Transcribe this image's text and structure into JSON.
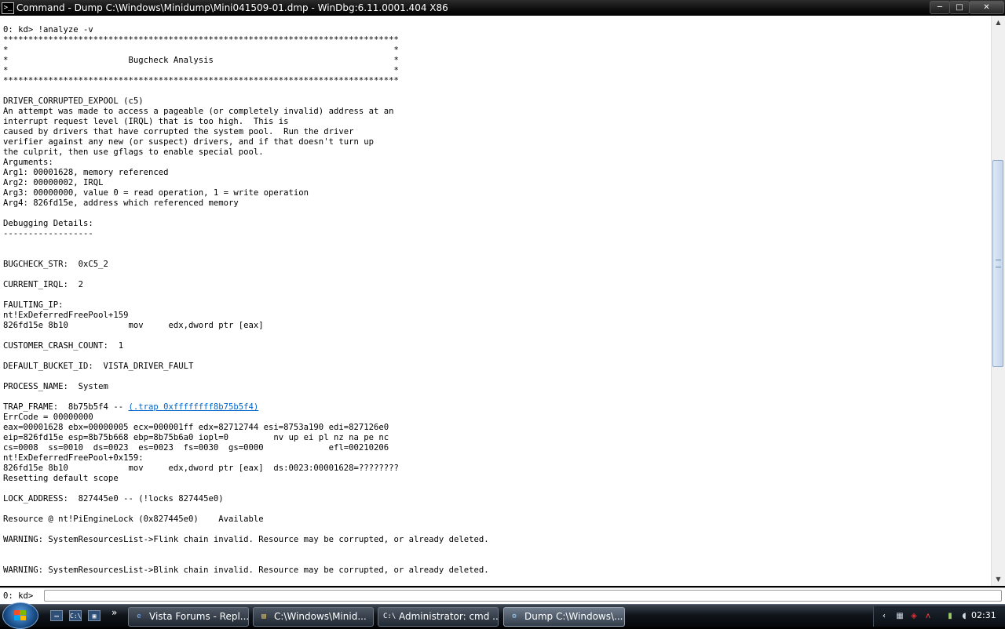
{
  "window": {
    "title": "Command - Dump C:\\Windows\\Minidump\\Mini041509-01.dmp - WinDbg:6.11.0001.404 X86",
    "icon_glyph": ">_",
    "minimize_glyph": "─",
    "maximize_glyph": "□",
    "close_glyph": "✕"
  },
  "output": {
    "lines_before_link": "0: kd> !analyze -v\n*******************************************************************************\n*                                                                             *\n*                        Bugcheck Analysis                                    *\n*                                                                             *\n*******************************************************************************\n\nDRIVER_CORRUPTED_EXPOOL (c5)\nAn attempt was made to access a pageable (or completely invalid) address at an\ninterrupt request level (IRQL) that is too high.  This is\ncaused by drivers that have corrupted the system pool.  Run the driver\nverifier against any new (or suspect) drivers, and if that doesn't turn up\nthe culprit, then use gflags to enable special pool.\nArguments:\nArg1: 00001628, memory referenced\nArg2: 00000002, IRQL\nArg3: 00000000, value 0 = read operation, 1 = write operation\nArg4: 826fd15e, address which referenced memory\n\nDebugging Details:\n------------------\n\n\nBUGCHECK_STR:  0xC5_2\n\nCURRENT_IRQL:  2\n\nFAULTING_IP:\nnt!ExDeferredFreePool+159\n826fd15e 8b10            mov     edx,dword ptr [eax]\n\nCUSTOMER_CRASH_COUNT:  1\n\nDEFAULT_BUCKET_ID:  VISTA_DRIVER_FAULT\n\nPROCESS_NAME:  System\n\nTRAP_FRAME:  8b75b5f4 -- ",
    "trap_link": "(.trap 0xffffffff8b75b5f4)",
    "lines_after_link": "\nErrCode = 00000000\neax=00001628 ebx=00000005 ecx=000001ff edx=82712744 esi=8753a190 edi=827126e0\neip=826fd15e esp=8b75b668 ebp=8b75b6a0 iopl=0         nv up ei pl nz na pe nc\ncs=0008  ss=0010  ds=0023  es=0023  fs=0030  gs=0000             efl=00210206\nnt!ExDeferredFreePool+0x159:\n826fd15e 8b10            mov     edx,dword ptr [eax]  ds:0023:00001628=????????\nResetting default scope\n\nLOCK_ADDRESS:  827445e0 -- (!locks 827445e0)\n\nResource @ nt!PiEngineLock (0x827445e0)    Available\n\nWARNING: SystemResourcesList->Flink chain invalid. Resource may be corrupted, or already deleted.\n\n\nWARNING: SystemResourcesList->Blink chain invalid. Resource may be corrupted, or already deleted."
  },
  "command": {
    "prompt": "0: kd>",
    "value": ""
  },
  "scrollbar": {
    "up_glyph": "▲",
    "down_glyph": "▼",
    "position_fraction": 0.35
  },
  "taskbar": {
    "quicklaunch": [
      {
        "name": "show-desktop",
        "glyph": "▭"
      },
      {
        "name": "cmd",
        "glyph": "C:\\"
      },
      {
        "name": "switch-windows",
        "glyph": "▣"
      }
    ],
    "more_glyph": "»",
    "tasks": [
      {
        "label": "Vista Forums - Repl...",
        "icon": "e",
        "icon_color": "#6fb3ff",
        "active": false
      },
      {
        "label": "C:\\Windows\\Minid...",
        "icon": "▤",
        "icon_color": "#f2d36b",
        "active": false
      },
      {
        "label": "Administrator: cmd ...",
        "icon": "C:\\",
        "icon_color": "#ffffff",
        "active": false
      },
      {
        "label": "Dump C:\\Windows\\...",
        "icon": "⚙",
        "icon_color": "#9fd2ff",
        "active": true
      }
    ],
    "tray_arrow": "‹",
    "tray_icons": [
      {
        "name": "network",
        "glyph": "▦",
        "color": "#cfd8e3"
      },
      {
        "name": "antivirus",
        "glyph": "◈",
        "color": "#e03030"
      },
      {
        "name": "pdf",
        "glyph": "ᴧ",
        "color": "#ff4444"
      },
      {
        "name": "device",
        "glyph": "▮",
        "color": "#9ecb6a"
      },
      {
        "name": "volume",
        "glyph": "◖",
        "color": "#cfd8e3"
      }
    ],
    "clock": "02:31"
  }
}
